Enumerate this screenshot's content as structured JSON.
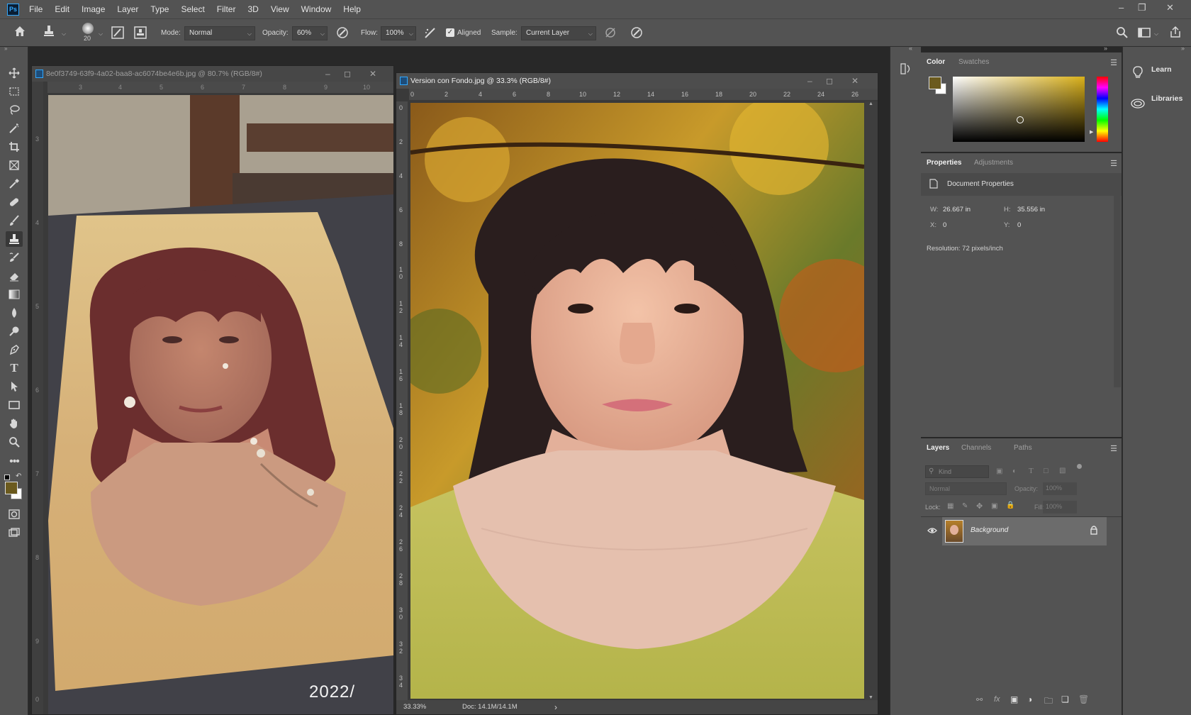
{
  "app": {
    "logo": "Ps"
  },
  "menu": [
    "File",
    "Edit",
    "Image",
    "Layer",
    "Type",
    "Select",
    "Filter",
    "3D",
    "View",
    "Window",
    "Help"
  ],
  "options": {
    "brush_size": "20",
    "mode_label": "Mode:",
    "mode_value": "Normal",
    "opacity_label": "Opacity:",
    "opacity_value": "60%",
    "flow_label": "Flow:",
    "flow_value": "100%",
    "aligned_label": "Aligned",
    "aligned_checked": true,
    "sample_label": "Sample:",
    "sample_value": "Current Layer"
  },
  "documents": {
    "left": {
      "title": "8e0f3749-63f9-4a02-baa8-ac6074be4e6b.jpg @ 80.7% (RGB/8#)",
      "ruler_h": [
        "3",
        "4",
        "5",
        "6",
        "7",
        "8",
        "9",
        "10"
      ],
      "ruler_v": [
        "3",
        "4",
        "5",
        "6",
        "7",
        "8",
        "9",
        "0"
      ],
      "watermark": "2022/"
    },
    "right": {
      "title": "Version con Fondo.jpg @ 33.3% (RGB/8#)",
      "ruler_h": [
        "0",
        "2",
        "4",
        "6",
        "8",
        "10",
        "12",
        "14",
        "16",
        "18",
        "20",
        "22",
        "24",
        "26"
      ],
      "ruler_v": [
        "0",
        "2",
        "4",
        "6",
        "8",
        "1 0",
        "1 2",
        "1 4",
        "1 6",
        "1 8",
        "2 0",
        "2 2",
        "2 4",
        "2 6",
        "2 8",
        "3 0",
        "3 2",
        "3 4"
      ],
      "zoom": "33.33%",
      "doc_size": "Doc: 14.1M/14.1M"
    }
  },
  "color_panel": {
    "tabs": [
      "Color",
      "Swatches"
    ],
    "foreground": "#6b5a1e",
    "background": "#ffffff"
  },
  "properties_panel": {
    "tabs": [
      "Properties",
      "Adjustments"
    ],
    "section": "Document Properties",
    "w_label": "W:",
    "w_value": "26.667 in",
    "h_label": "H:",
    "h_value": "35.556 in",
    "x_label": "X:",
    "x_value": "0",
    "y_label": "Y:",
    "y_value": "0",
    "resolution": "Resolution: 72 pixels/inch"
  },
  "layers_panel": {
    "tabs": [
      "Layers",
      "Channels",
      "Paths"
    ],
    "filter_placeholder": "Kind",
    "blend_mode": "Normal",
    "opacity_label": "Opacity:",
    "opacity_value": "100%",
    "lock_label": "Lock:",
    "fill_label": "Fill:",
    "fill_value": "100%",
    "layer_name": "Background"
  },
  "learn_panel": {
    "learn": "Learn",
    "libraries": "Libraries"
  },
  "icons": [
    "home-icon",
    "clone-stamp-icon",
    "move-icon",
    "marquee-icon",
    "lasso-icon",
    "magic-wand-icon",
    "crop-icon",
    "frame-icon",
    "eyedropper-icon",
    "healing-brush-icon",
    "brush-icon",
    "stamp-icon",
    "history-brush-icon",
    "eraser-icon",
    "gradient-icon",
    "blur-icon",
    "dodge-icon",
    "pen-icon",
    "type-icon",
    "path-select-icon",
    "rectangle-icon",
    "hand-icon",
    "zoom-icon",
    "more-tools-icon",
    "quick-mask-icon",
    "screen-mode-icon",
    "search-icon",
    "workspace-icon",
    "share-icon",
    "eye-icon",
    "lock-icon",
    "bulb-icon",
    "libraries-icon"
  ]
}
